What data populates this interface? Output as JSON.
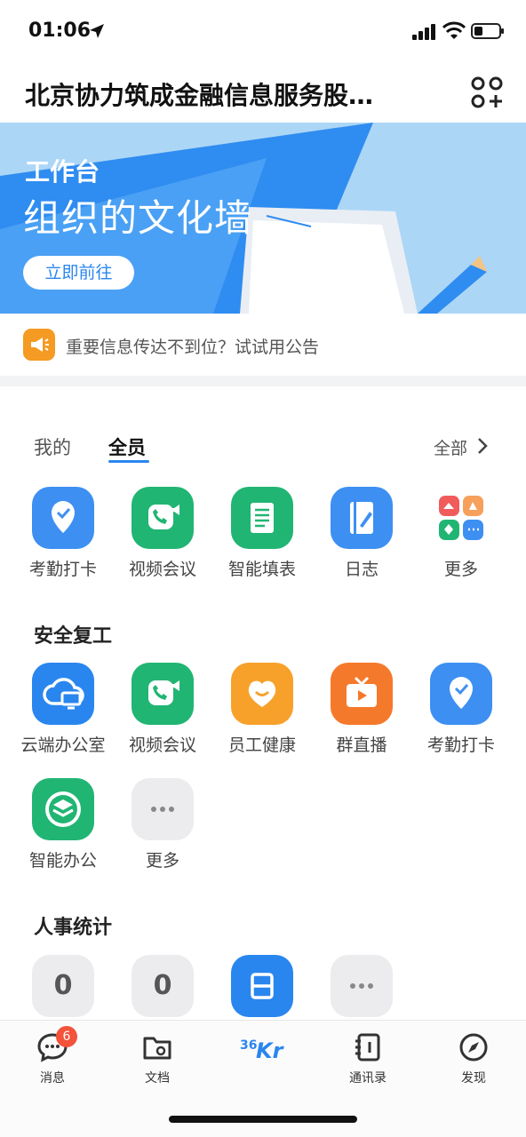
{
  "status_bar": {
    "time": "01:06"
  },
  "header": {
    "org_name": "北京协力筑成金融信息服务股…"
  },
  "banner": {
    "kicker": "工作台",
    "title": "组织的文化墙",
    "button_label": "立即前往"
  },
  "notice": {
    "text": "重要信息传达不到位？试试用公告"
  },
  "tabs": {
    "mine": "我的",
    "all": "全员",
    "more_link": "全部"
  },
  "apps_all": [
    {
      "label": "考勤打卡",
      "icon": "location-check-icon",
      "color": "#3d8ff2"
    },
    {
      "label": "视频会议",
      "icon": "video-call-icon",
      "color": "#21b573"
    },
    {
      "label": "智能填表",
      "icon": "form-scroll-icon",
      "color": "#21b573"
    },
    {
      "label": "日志",
      "icon": "journal-icon",
      "color": "#3d8ff2"
    },
    {
      "label": "更多",
      "icon": "more-grid-icon",
      "color": "#ffffff"
    }
  ],
  "section_safe": {
    "title": "安全复工",
    "apps": [
      {
        "label": "云端办公室",
        "icon": "cloud-office-icon",
        "color": "#2a86ef"
      },
      {
        "label": "视频会议",
        "icon": "video-call-icon",
        "color": "#21b573"
      },
      {
        "label": "员工健康",
        "icon": "heart-icon",
        "color": "#f7a12b"
      },
      {
        "label": "群直播",
        "icon": "live-tv-icon",
        "color": "#f5792a"
      },
      {
        "label": "考勤打卡",
        "icon": "location-check-icon",
        "color": "#3d8ff2"
      },
      {
        "label": "智能办公",
        "icon": "layers-icon",
        "color": "#21b573"
      },
      {
        "label": "更多",
        "icon": "ellipsis-icon",
        "color": "#ececee"
      }
    ]
  },
  "section_hr": {
    "title": "人事统计",
    "stats": [
      {
        "value": "0"
      },
      {
        "value": "0"
      }
    ]
  },
  "tabbar": {
    "messages": {
      "label": "消息",
      "badge": "6"
    },
    "docs": {
      "label": "文档"
    },
    "center": {
      "label": "36Kr"
    },
    "contacts": {
      "label": "通讯录"
    },
    "discover": {
      "label": "发现"
    }
  }
}
